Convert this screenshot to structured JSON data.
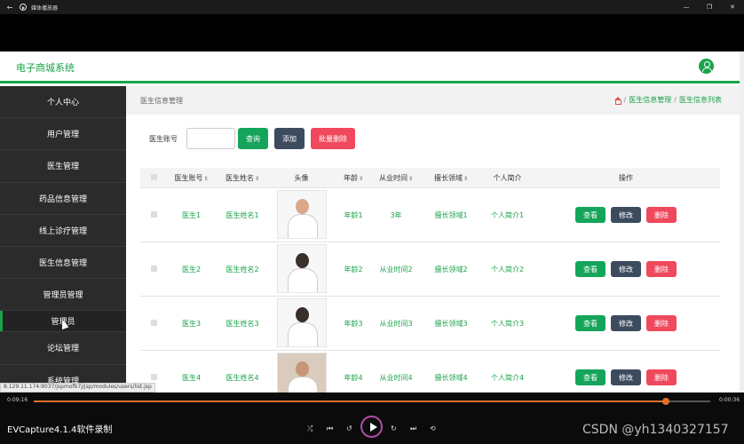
{
  "player": {
    "window_title": "媒体播放器",
    "elapsed": "0:09:16",
    "duration": "0:00:36",
    "progress": 0.935,
    "caption": "EVCapture4.1.4软件录制",
    "watermark": "CSDN @yh1340327157"
  },
  "app": {
    "brand": "电子商城系统",
    "accent_color": "#1aa34a"
  },
  "sidebar": {
    "items": [
      {
        "label": "个人中心"
      },
      {
        "label": "用户管理"
      },
      {
        "label": "医生管理"
      },
      {
        "label": "药品信息管理"
      },
      {
        "label": "线上诊疗管理"
      },
      {
        "label": "医生信息管理"
      },
      {
        "label": "管理员管理"
      },
      {
        "label": "管理员"
      },
      {
        "label": "论坛管理"
      },
      {
        "label": "系统管理"
      }
    ]
  },
  "page": {
    "title": "医生信息管理",
    "breadcrumb": [
      "医生信息管理",
      "医生信息列表"
    ]
  },
  "search": {
    "label": "医生账号",
    "placeholder": "",
    "query_button": "查询",
    "add_button": "添加",
    "batch_delete_button": "批量删除"
  },
  "table": {
    "headers": [
      "医生账号",
      "医生姓名",
      "头像",
      "年龄",
      "从业时间",
      "擅长领域",
      "个人简介",
      "操作"
    ],
    "rows": [
      {
        "account": "医生1",
        "name": "医生姓名1",
        "photo": "male-doctor",
        "age": "年龄1",
        "years": "3年",
        "field": "擅长领域1",
        "intro": "个人简介1"
      },
      {
        "account": "医生2",
        "name": "医生姓名2",
        "photo": "female-nurse",
        "age": "年龄2",
        "years": "从业时间2",
        "field": "擅长领域2",
        "intro": "个人简介2"
      },
      {
        "account": "医生3",
        "name": "医生姓名3",
        "photo": "female-nurse",
        "age": "年龄3",
        "years": "从业时间3",
        "field": "擅长领域3",
        "intro": "个人简介3"
      },
      {
        "account": "医生4",
        "name": "医生姓名4",
        "photo": "male-doctor",
        "age": "年龄4",
        "years": "从业时间4",
        "field": "擅长领域4",
        "intro": "个人简介4"
      }
    ],
    "actions": {
      "view": "查看",
      "edit": "修改",
      "delete": "删除"
    }
  },
  "status_url": "8.129.11.174:9037/jspmofb7j/jsp/modules/users/list.jsp"
}
